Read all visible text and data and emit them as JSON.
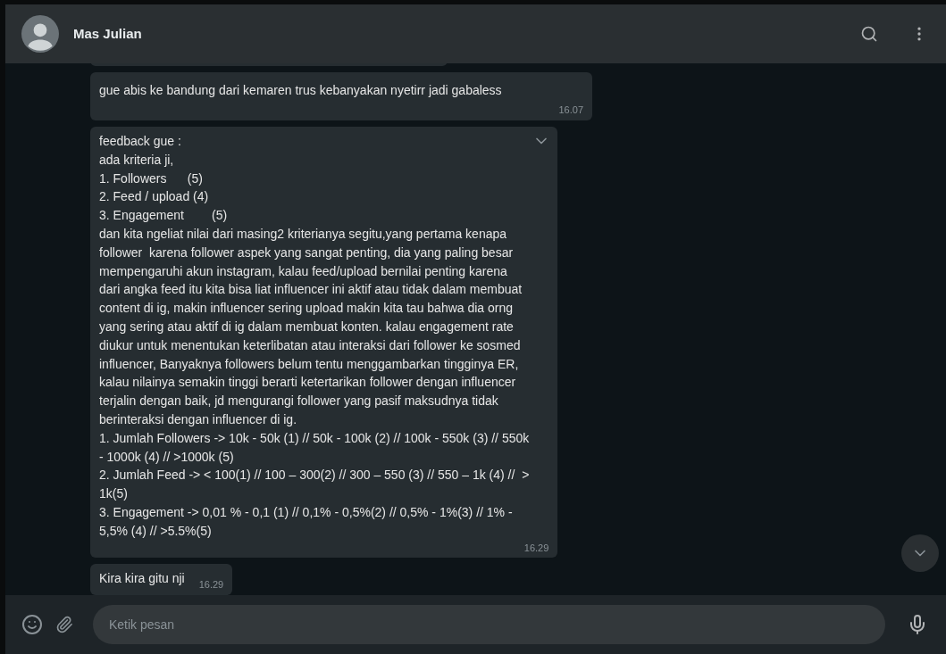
{
  "header": {
    "contact_name": "Mas Julian"
  },
  "messages": [
    {
      "kind": "fragment"
    },
    {
      "kind": "text",
      "lines": [
        "gue abis ke bandung dari kemaren trus kebanyakan nyetirr jadi gabaless"
      ],
      "time": "16.07"
    },
    {
      "kind": "expandable",
      "lines": [
        "feedback gue :",
        "ada kriteria ji,",
        "1. Followers      (5)",
        "2. Feed / upload (4)",
        "3. Engagement        (5)",
        "dan kita ngeliat nilai dari masing2 kriterianya segitu,yang pertama kenapa",
        "follower  karena follower aspek yang sangat penting, dia yang paling besar",
        "mempengaruhi akun instagram, kalau feed/upload bernilai penting karena",
        "dari angka feed itu kita bisa liat influencer ini aktif atau tidak dalam membuat",
        "content di ig, makin influencer sering upload makin kita tau bahwa dia orng",
        "yang sering atau aktif di ig dalam membuat konten. kalau engagement rate",
        "diukur untuk menentukan keterlibatan atau interaksi dari follower ke sosmed",
        "influencer, Banyaknya followers belum tentu menggambarkan tingginya ER,",
        "kalau nilainya semakin tinggi berarti ketertarikan follower dengan influencer",
        "terjalin dengan baik, jd mengurangi follower yang pasif maksudnya tidak",
        "berinteraksi dengan influencer di ig.",
        "1. Jumlah Followers -> 10k - 50k (1) // 50k - 100k (2) // 100k - 550k (3) // 550k",
        "- 1000k (4) // >1000k (5)",
        "2. Jumlah Feed -> < 100(1) // 100 – 300(2) // 300 – 550 (3) // 550 – 1k (4) //  >",
        "1k(5)",
        "3. Engagement -> 0,01 % - 0,1 (1) // 0,1% - 0,5%(2) // 0,5% - 1%(3) // 1% -",
        "5,5% (4) // >5.5%(5)"
      ],
      "time": "16.29"
    },
    {
      "kind": "short",
      "lines": [
        "Kira kira gitu nji"
      ],
      "time": "16.29"
    }
  ],
  "composer": {
    "placeholder": "Ketik pesan"
  }
}
